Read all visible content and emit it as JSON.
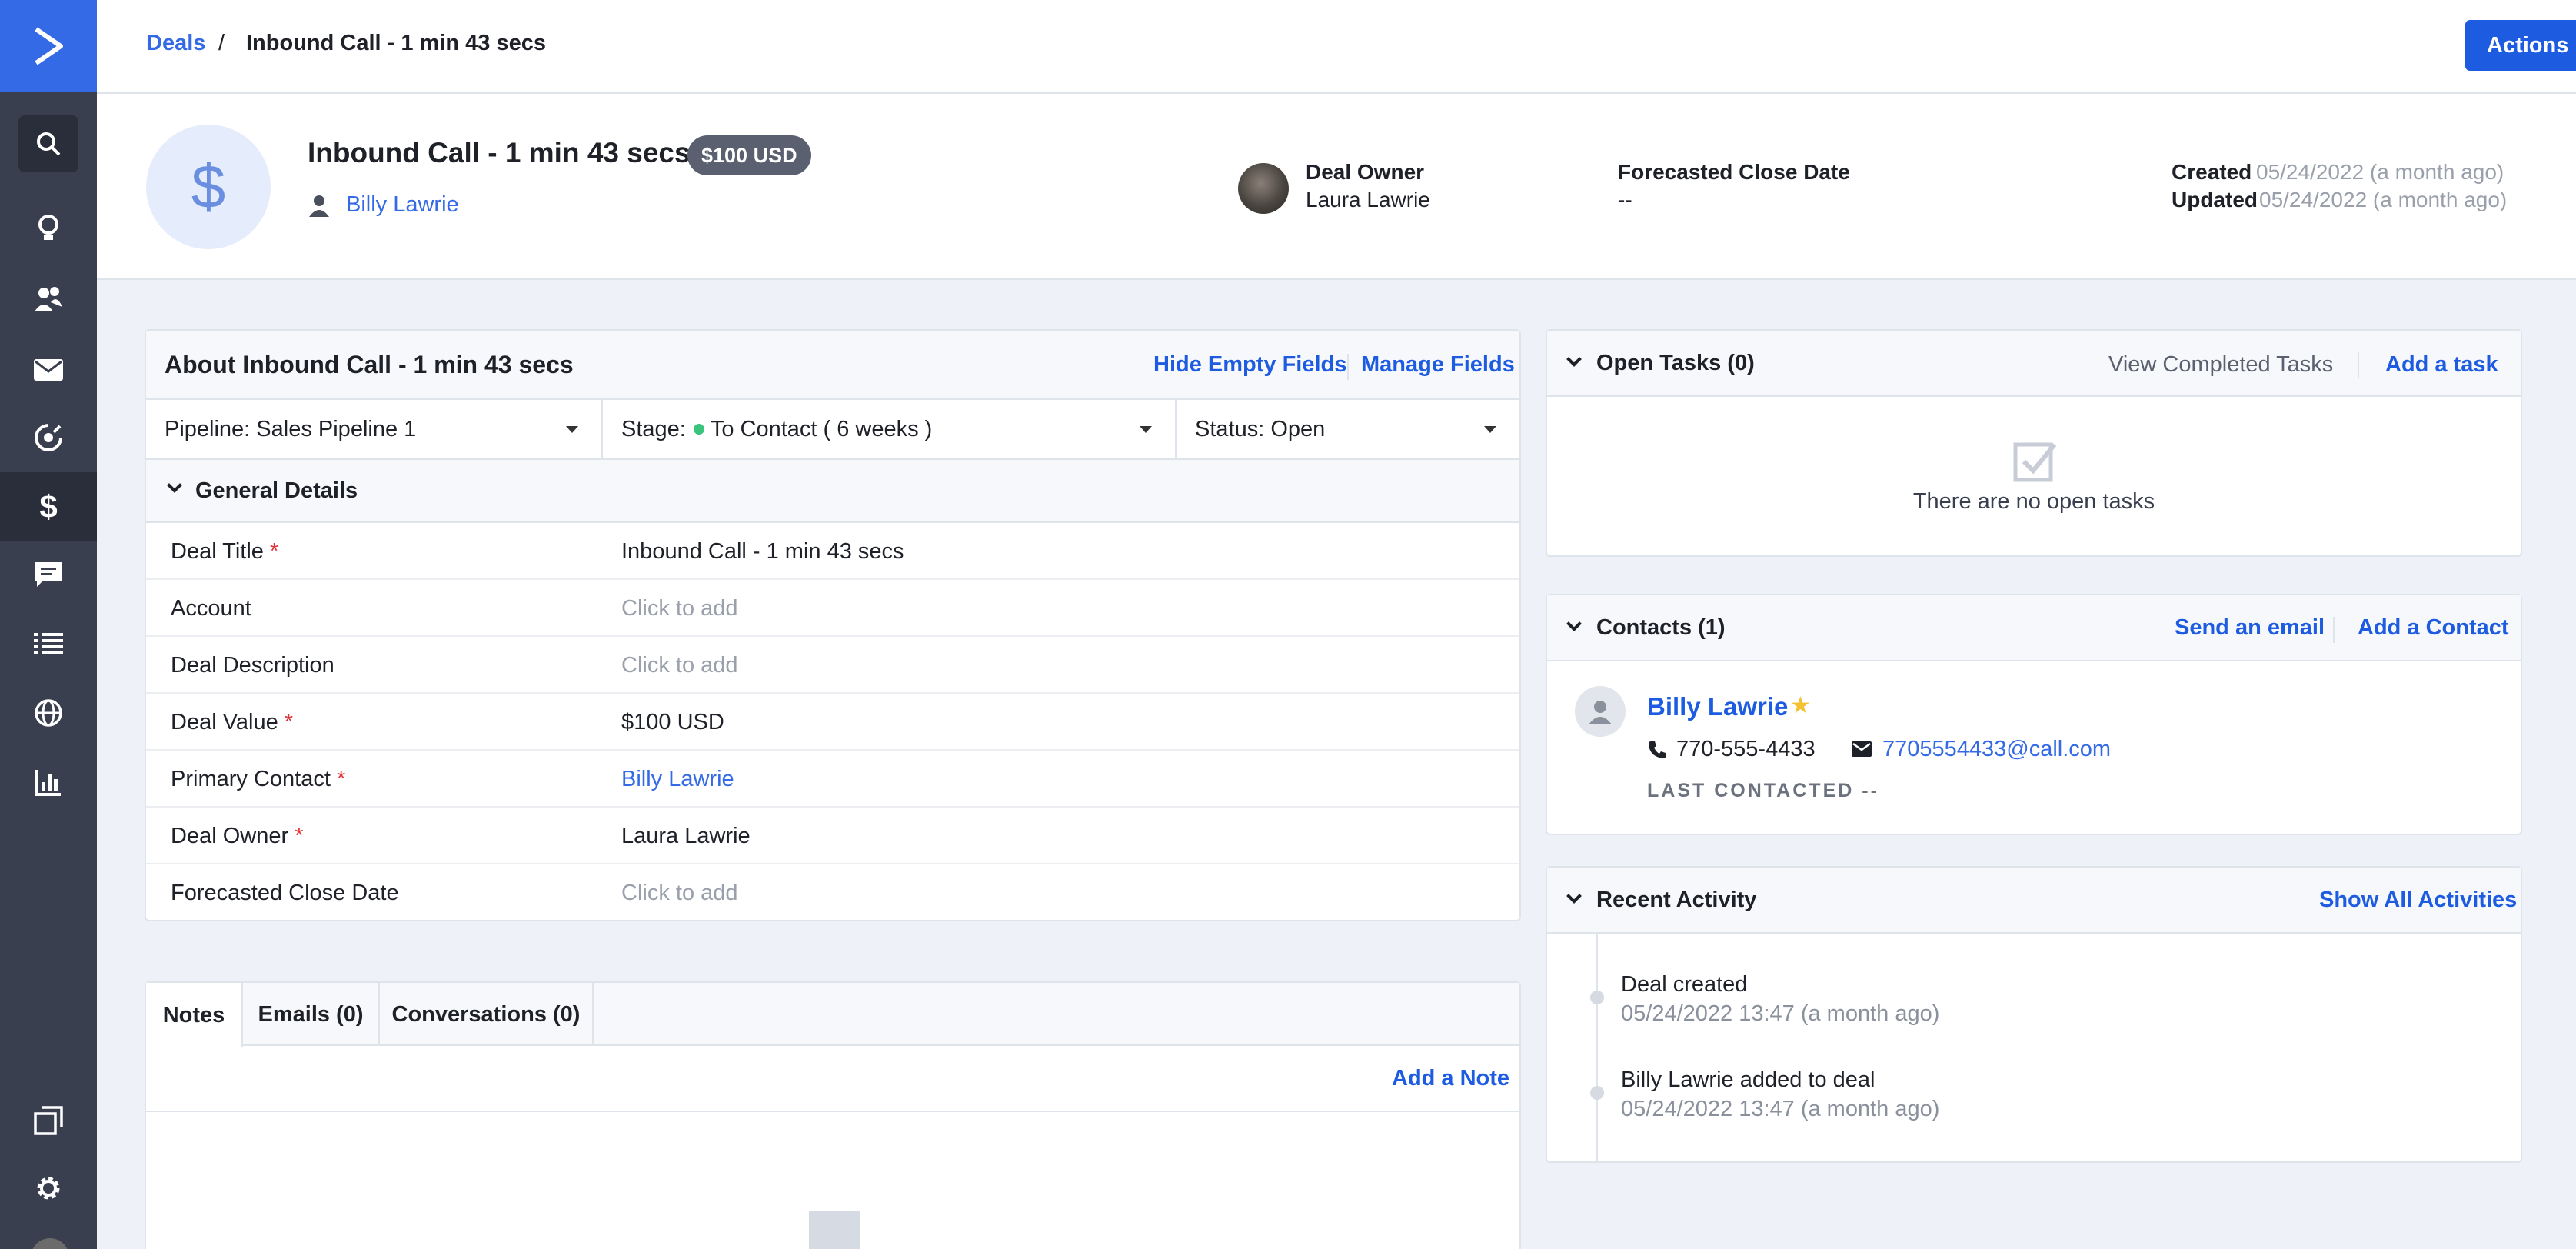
{
  "sidebar": {
    "logo_icon": "chevron-right-logo-icon",
    "items": [
      {
        "name": "search-icon",
        "active": false
      },
      {
        "name": "lightbulb-icon",
        "active": false
      },
      {
        "name": "contacts-icon",
        "active": false
      },
      {
        "name": "envelope-icon",
        "active": false
      },
      {
        "name": "automation-icon",
        "active": false
      },
      {
        "name": "dollar-icon",
        "active": true
      },
      {
        "name": "conversations-icon",
        "active": false
      },
      {
        "name": "list-icon",
        "active": false
      },
      {
        "name": "globe-icon",
        "active": false
      },
      {
        "name": "reports-icon",
        "active": false
      },
      {
        "name": "pages-icon",
        "active": false
      },
      {
        "name": "gear-icon",
        "active": false
      }
    ]
  },
  "breadcrumb": {
    "parent": "Deals",
    "separator": "/",
    "current": "Inbound Call - 1 min 43 secs"
  },
  "actions_label": "Actions",
  "deal": {
    "icon": "$",
    "title": "Inbound Call - 1 min 43 secs",
    "value_badge": "$100 USD",
    "primary_contact": "Billy Lawrie",
    "owner_label": "Deal Owner",
    "owner": "Laura Lawrie",
    "close_label": "Forecasted Close Date",
    "close_value": "--",
    "created_label": "Created",
    "created_value": "05/24/2022 (a month ago)",
    "updated_label": "Updated",
    "updated_value": "05/24/2022 (a month ago)"
  },
  "about": {
    "title": "About Inbound Call - 1 min 43 secs",
    "hide_empty": "Hide Empty Fields",
    "manage_fields": "Manage Fields",
    "pipeline": "Pipeline: Sales Pipeline 1",
    "stage_label": "Stage:",
    "stage_value": "To Contact ( 6 weeks )",
    "status": "Status: Open",
    "section_title": "General Details",
    "fields": [
      {
        "label": "Deal Title",
        "required": "*",
        "value": "Inbound Call - 1 min 43 secs"
      },
      {
        "label": "Account",
        "required": "",
        "value": "Click to add"
      },
      {
        "label": "Deal Description",
        "required": "",
        "value": "Click to add"
      },
      {
        "label": "Deal Value",
        "required": "*",
        "value": "$100 USD"
      },
      {
        "label": "Primary Contact",
        "required": "*",
        "value": "Billy Lawrie"
      },
      {
        "label": "Deal Owner",
        "required": "*",
        "value": "Laura Lawrie"
      },
      {
        "label": "Forecasted Close Date",
        "required": "",
        "value": "Click to add"
      }
    ]
  },
  "tabs": {
    "items": [
      "Notes",
      "Emails (0)",
      "Conversations (0)"
    ],
    "active": "Notes",
    "add_note": "Add a Note"
  },
  "tasks": {
    "title": "Open Tasks (0)",
    "view_completed": "View Completed Tasks",
    "add": "Add a task",
    "empty": "There are no open tasks"
  },
  "contacts": {
    "title": "Contacts (1)",
    "send_email": "Send an email",
    "add": "Add a Contact",
    "name": "Billy Lawrie",
    "phone": "770-555-4433",
    "email": "7705554433@call.com",
    "last_contacted": "LAST CONTACTED --"
  },
  "activity": {
    "title": "Recent Activity",
    "show_all": "Show All Activities",
    "items": [
      {
        "text": "Deal created",
        "time": "05/24/2022 13:47 (a month ago)"
      },
      {
        "text": "Billy Lawrie added to deal",
        "time": "05/24/2022 13:47 (a month ago)"
      }
    ]
  },
  "colors": {
    "brand": "#356ae6",
    "primary_button": "#1d5ce0",
    "sidebar": "#3a3f50",
    "stage_dot": "#3ac47d",
    "required": "#e0353a",
    "star": "#f2c230"
  }
}
